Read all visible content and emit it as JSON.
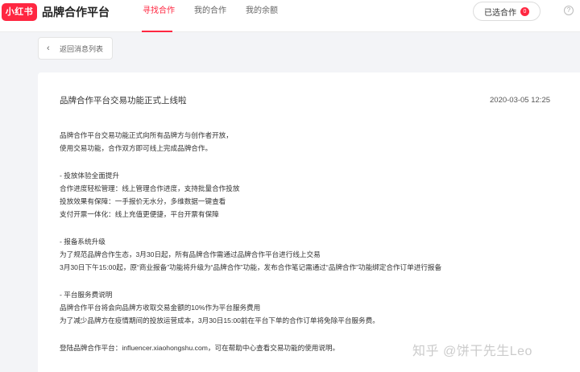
{
  "header": {
    "logo_text": "小红书",
    "brand_title": "品牌合作平台",
    "tabs": [
      {
        "label": "寻找合作",
        "active": true
      },
      {
        "label": "我的合作",
        "active": false
      },
      {
        "label": "我的余额",
        "active": false
      }
    ],
    "selected_button_label": "已选合作",
    "selected_count": "0",
    "accent_color": "#ff2741"
  },
  "back_button": {
    "label": "返回消息列表"
  },
  "message": {
    "title": "品牌合作平台交易功能正式上线啦",
    "date": "2020-03-05 12:25",
    "paragraphs": [
      [
        "品牌合作平台交易功能正式向所有品牌方与创作者开放，",
        "使用交易功能，合作双方即可线上完成品牌合作。"
      ],
      [
        "- 投放体验全面提升",
        "合作进度轻松管理：线上管理合作进度，支持批量合作投放",
        "投放效果有保障：一手报价无水分，多维数据一键查看",
        "支付开票一体化：线上充值更便捷，平台开票有保障"
      ],
      [
        "- 报备系统升级",
        "为了规范品牌合作生态，3月30日起，所有品牌合作需通过品牌合作平台进行线上交易",
        "3月30日下午15:00起，原“商业报备”功能将升级为“品牌合作”功能，发布合作笔记需通过“品牌合作”功能绑定合作订单进行报备"
      ],
      [
        "- 平台服务费说明",
        "品牌合作平台将会向品牌方收取交易金额的10%作为平台服务费用",
        "为了减少品牌方在疫情期间的投放运营成本，3月30日15:00前在平台下单的合作订单将免除平台服务费。"
      ],
      [
        "登陆品牌合作平台：influencer.xiaohongshu.com，可在帮助中心查看交易功能的使用说明。"
      ]
    ]
  },
  "watermark": "知乎 @饼干先生Leo"
}
